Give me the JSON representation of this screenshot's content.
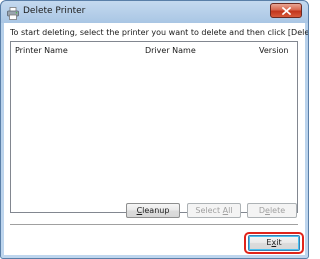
{
  "window": {
    "title": "Delete Printer"
  },
  "dialog": {
    "instruction": "To start deleting, select the printer you want to delete and then click [Delete]."
  },
  "list": {
    "columns": [
      "Printer Name",
      "Driver Name",
      "Version"
    ],
    "rows": []
  },
  "buttons": {
    "cleanup_pre": "",
    "cleanup_mn": "C",
    "cleanup_post": "leanup",
    "selectall_pre": "Select ",
    "selectall_mn": "A",
    "selectall_post": "ll",
    "delete_pre": "D",
    "delete_mn": "e",
    "delete_post": "lete",
    "exit_pre": "E",
    "exit_mn": "x",
    "exit_post": "it"
  },
  "states": {
    "select_all_enabled": false,
    "delete_enabled": false
  },
  "colors": {
    "accent_highlight": "#e0241a",
    "close_button": "#c2361c",
    "window_frame": "#bfd6ee"
  },
  "icons": {
    "title": "printer-icon",
    "close": "close-icon"
  }
}
